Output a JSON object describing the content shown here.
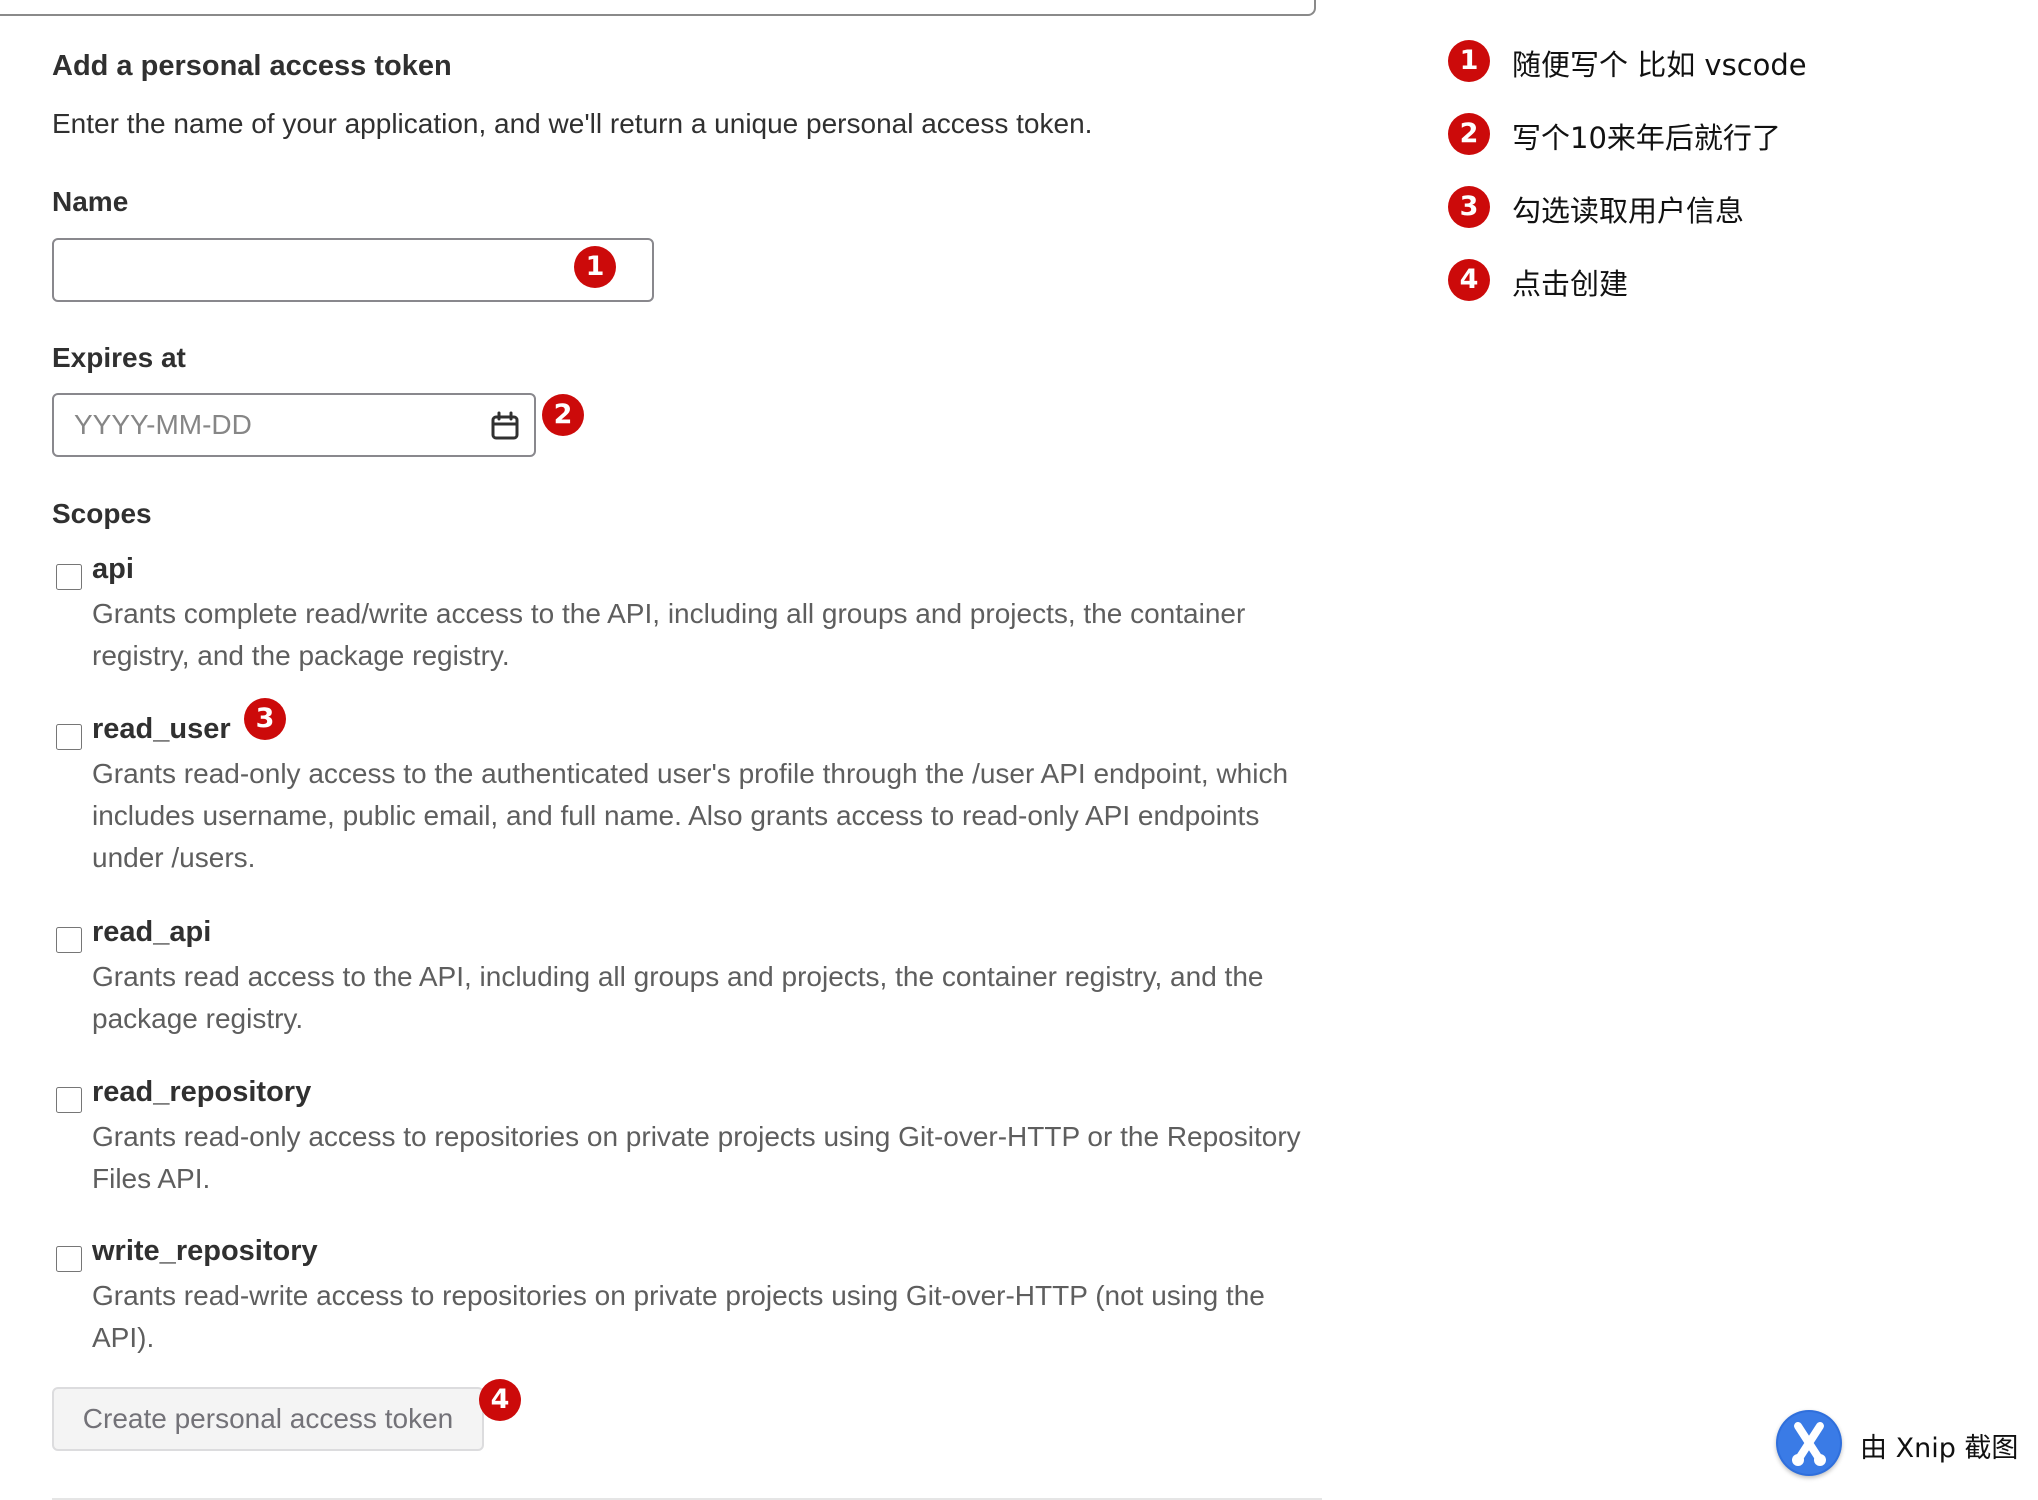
{
  "form": {
    "title": "Add a personal access token",
    "description": "Enter the name of your application, and we'll return a unique personal access token.",
    "name_label": "Name",
    "name_value": "",
    "expires_label": "Expires at",
    "expires_placeholder": "YYYY-MM-DD",
    "scopes_label": "Scopes",
    "scopes": [
      {
        "name": "api",
        "checked": false,
        "description": "Grants complete read/write access to the API, including all groups and projects, the container registry, and the package registry."
      },
      {
        "name": "read_user",
        "checked": false,
        "description": "Grants read-only access to the authenticated user's profile through the /user API endpoint, which includes username, public email, and full name. Also grants access to read-only API endpoints under /users."
      },
      {
        "name": "read_api",
        "checked": false,
        "description": "Grants read access to the API, including all groups and projects, the container registry, and the package registry."
      },
      {
        "name": "read_repository",
        "checked": false,
        "description": "Grants read-only access to repositories on private projects using Git-over-HTTP or the Repository Files API."
      },
      {
        "name": "write_repository",
        "checked": false,
        "description": "Grants read-write access to repositories on private projects using Git-over-HTTP (not using the API)."
      }
    ],
    "submit_label": "Create personal access token"
  },
  "markers": {
    "m1": "1",
    "m2": "2",
    "m3": "3",
    "m4": "4",
    "color": "#cc0a0a"
  },
  "notes": [
    {
      "number": "1",
      "text": "随便写个 比如 vscode"
    },
    {
      "number": "2",
      "text": "写个10来年后就行了"
    },
    {
      "number": "3",
      "text": "勾选读取用户信息"
    },
    {
      "number": "4",
      "text": "点击创建"
    }
  ],
  "watermark": {
    "text": "由 Xnip 截图",
    "logo_icon": "xnip-logo-icon"
  }
}
